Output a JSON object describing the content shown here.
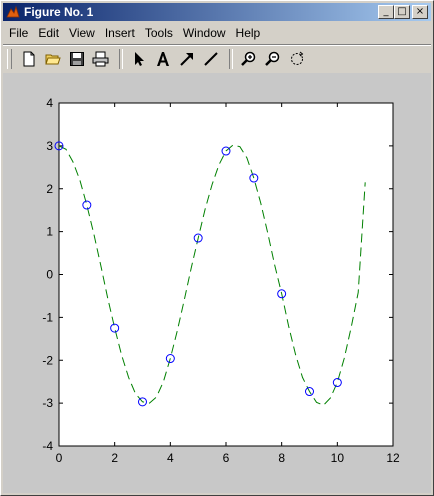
{
  "window": {
    "title": "Figure No. 1"
  },
  "title_buttons": {
    "minimize": "_",
    "maximize": "□",
    "close": "×"
  },
  "menu": [
    "File",
    "Edit",
    "View",
    "Insert",
    "Tools",
    "Window",
    "Help"
  ],
  "toolbar": {
    "tools": [
      "new-file-icon",
      "open-folder-icon",
      "save-icon",
      "print-icon",
      "select-arrow-icon",
      "text-tool-icon",
      "arrow-tool-icon",
      "line-tool-icon",
      "zoom-in-icon",
      "zoom-out-icon",
      "rotate-3d-icon"
    ]
  },
  "colors": {
    "markers": "#0000ff",
    "curve": "#008000",
    "axes_bg": "#ffffff",
    "figure_bg": "#c8c8c8"
  },
  "chart_data": {
    "type": "line",
    "xlim": [
      0,
      12
    ],
    "ylim": [
      -4,
      4
    ],
    "xticks": [
      "0",
      "2",
      "4",
      "6",
      "8",
      "10",
      "12"
    ],
    "yticks": [
      "4",
      "3",
      "2",
      "1",
      "0",
      "-1",
      "-2",
      "-3",
      "-4"
    ],
    "series": [
      {
        "style": "markers-circle",
        "x": [
          0,
          1,
          2,
          3,
          4,
          5,
          6,
          7,
          8,
          9,
          10
        ],
        "y": [
          3.0,
          1.62,
          -1.25,
          -2.97,
          -1.96,
          0.85,
          2.88,
          2.25,
          -0.45,
          -2.73,
          -2.52
        ]
      },
      {
        "style": "dashed-line",
        "x": [
          0,
          0.25,
          0.5,
          0.75,
          1,
          1.25,
          1.5,
          1.75,
          2,
          2.25,
          2.5,
          2.75,
          3,
          3.25,
          3.5,
          3.75,
          4,
          4.25,
          4.5,
          4.75,
          5,
          5.25,
          5.5,
          5.75,
          6,
          6.25,
          6.5,
          6.75,
          7,
          7.25,
          7.5,
          7.75,
          8,
          8.25,
          8.5,
          8.75,
          9,
          9.25,
          9.5,
          9.75,
          10,
          10.25,
          10.5,
          10.75,
          11
        ],
        "y": [
          3.0,
          2.92,
          2.63,
          2.2,
          1.62,
          0.95,
          0.21,
          -0.55,
          -1.25,
          -1.88,
          -2.4,
          -2.78,
          -2.97,
          -3.0,
          -2.86,
          -2.5,
          -1.96,
          -1.31,
          -0.59,
          0.15,
          0.85,
          1.52,
          2.1,
          2.56,
          2.88,
          3.02,
          2.98,
          2.72,
          2.25,
          1.66,
          0.96,
          0.22,
          -0.45,
          -1.2,
          -1.87,
          -2.4,
          -2.73,
          -2.98,
          -3.05,
          -2.88,
          -2.52,
          -1.95,
          -1.22,
          -0.42,
          2.15
        ]
      }
    ]
  }
}
